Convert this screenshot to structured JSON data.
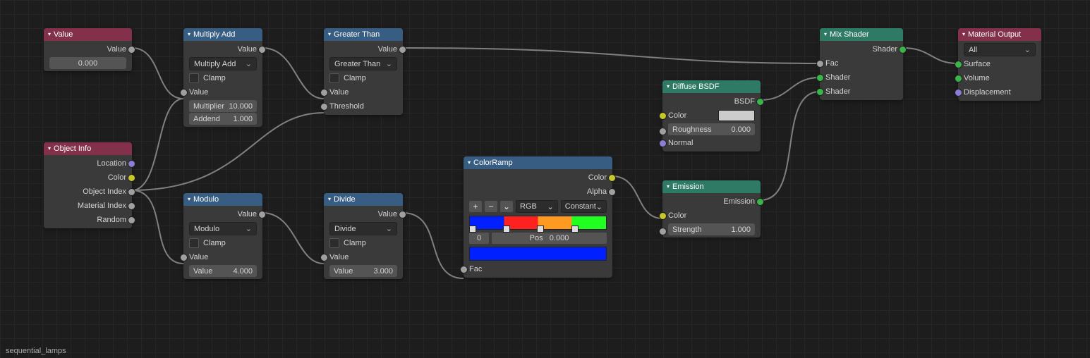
{
  "footer": "sequential_lamps",
  "nodes": {
    "value": {
      "title": "Value",
      "out": "Value",
      "val": "0.000"
    },
    "objinfo": {
      "title": "Object Info",
      "outs": [
        "Location",
        "Color",
        "Object Index",
        "Material Index",
        "Random"
      ]
    },
    "madd": {
      "title": "Multiply Add",
      "out": "Value",
      "mode": "Multiply Add",
      "clamp": "Clamp",
      "in0": "Value",
      "mul_l": "Multiplier",
      "mul_v": "10.000",
      "add_l": "Addend",
      "add_v": "1.000"
    },
    "gt": {
      "title": "Greater Than",
      "out": "Value",
      "mode": "Greater Than",
      "clamp": "Clamp",
      "in0": "Value",
      "in1": "Threshold"
    },
    "mod": {
      "title": "Modulo",
      "out": "Value",
      "mode": "Modulo",
      "clamp": "Clamp",
      "in0": "Value",
      "v_l": "Value",
      "v_v": "4.000"
    },
    "div": {
      "title": "Divide",
      "out": "Value",
      "mode": "Divide",
      "clamp": "Clamp",
      "in0": "Value",
      "v_l": "Value",
      "v_v": "3.000"
    },
    "cramp": {
      "title": "ColorRamp",
      "out_c": "Color",
      "out_a": "Alpha",
      "md1": "RGB",
      "md2": "Constant",
      "idx": "0",
      "pos_l": "Pos",
      "pos_v": "0.000",
      "fac": "Fac"
    },
    "diff": {
      "title": "Diffuse BSDF",
      "out": "BSDF",
      "in_c": "Color",
      "r_l": "Roughness",
      "r_v": "0.000",
      "n": "Normal"
    },
    "emit": {
      "title": "Emission",
      "out": "Emission",
      "in_c": "Color",
      "s_l": "Strength",
      "s_v": "1.000"
    },
    "mix": {
      "title": "Mix Shader",
      "out": "Shader",
      "fac": "Fac",
      "s1": "Shader",
      "s2": "Shader"
    },
    "mout": {
      "title": "Material Output",
      "mode": "All",
      "s": "Surface",
      "v": "Volume",
      "d": "Displacement"
    }
  }
}
